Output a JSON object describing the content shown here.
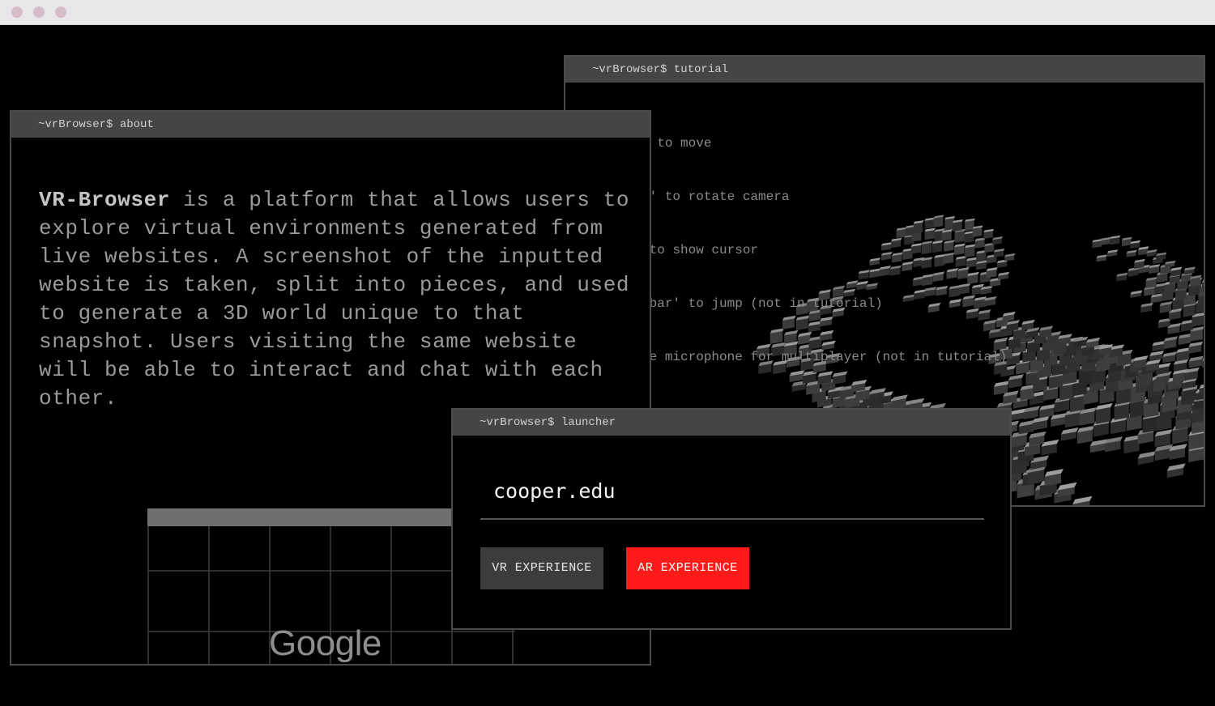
{
  "windows": {
    "tutorial": {
      "title": "~vrBrowser$ tutorial",
      "lines": [
        "'wasd' to move",
        "'mouse' to rotate camera",
        "'esc' to show cursor",
        "'spacebar' to jump (not in tutorial)",
        "'enable microphone for multiplayer (not in tutorial)"
      ]
    },
    "about": {
      "title": "~vrBrowser$ about",
      "brand": "VR-Browser",
      "description": " is a platform that allows users to explore virtual environments generated from live websites. A screenshot of the inputted website is taken, split into pieces, and used to generate a 3D world unique to that snapshot. Users visiting the same website will be able to interact and chat with each other.",
      "preview_logo": "Google"
    },
    "launcher": {
      "title": "~vrBrowser$ launcher",
      "url": "cooper.edu",
      "vr_button": "VR EXPERIENCE",
      "ar_button": "AR EXPERIENCE"
    }
  },
  "colors": {
    "ar_accent": "#ff1a1a",
    "titlebar": "#454545"
  }
}
